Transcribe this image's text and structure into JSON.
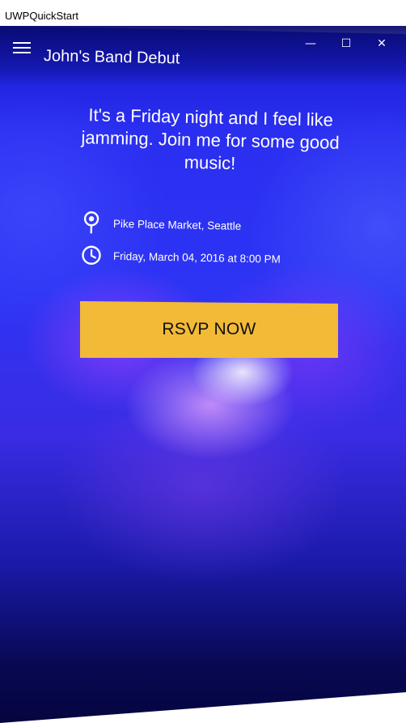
{
  "window": {
    "title": "UWPQuickStart",
    "controls": {
      "minimize": "—",
      "maximize": "☐",
      "close": "✕"
    }
  },
  "app": {
    "title": "John's Band Debut",
    "menu_icon": "hamburger-icon"
  },
  "event": {
    "headline": "It's a Friday night and I feel like jamming. Join me for some good music!",
    "location": "Pike Place Market, Seattle",
    "datetime": "Friday, March 04, 2016 at 8:00 PM",
    "location_icon": "map-pin-icon",
    "datetime_icon": "clock-icon"
  },
  "actions": {
    "rsvp_label": "RSVP NOW"
  },
  "colors": {
    "accent": "#f2ba37",
    "background_top": "#1418c9",
    "background_bottom": "#050540",
    "text": "#ffffff"
  }
}
